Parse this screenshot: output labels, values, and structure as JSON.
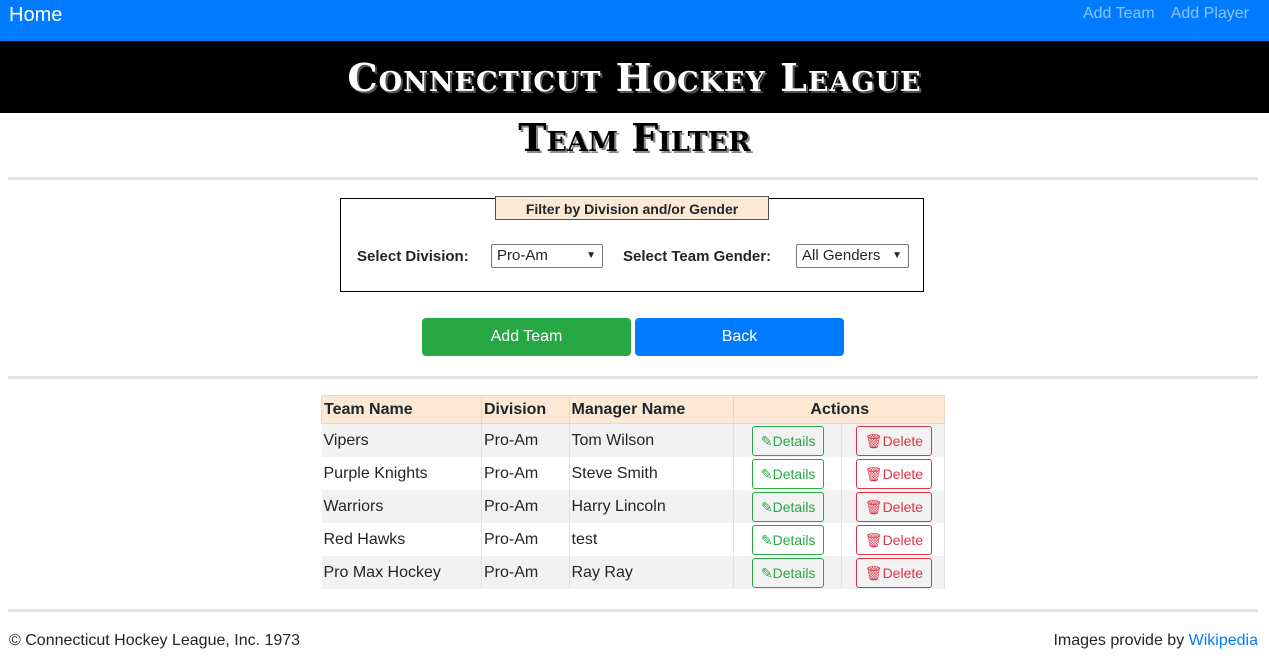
{
  "nav": {
    "brand": "Home",
    "links": [
      "Add Team",
      "Add Player"
    ]
  },
  "banner": {
    "title": "Connecticut Hockey League"
  },
  "page": {
    "title": "Team Filter"
  },
  "filter": {
    "legend": "Filter by Division and/or Gender",
    "division_label": "Select Division:",
    "division_value": "Pro-Am",
    "gender_label": "Select Team Gender:",
    "gender_value": "All Genders"
  },
  "buttons": {
    "add_team": "Add Team",
    "back": "Back"
  },
  "table": {
    "headers": [
      "Team Name",
      "Division",
      "Manager Name",
      "Actions"
    ],
    "details_label": "Details",
    "delete_label": "Delete",
    "rows": [
      {
        "team": "Vipers",
        "division": "Pro-Am",
        "manager": "Tom Wilson"
      },
      {
        "team": "Purple Knights",
        "division": "Pro-Am",
        "manager": "Steve Smith"
      },
      {
        "team": "Warriors",
        "division": "Pro-Am",
        "manager": "Harry Lincoln"
      },
      {
        "team": "Red Hawks",
        "division": "Pro-Am",
        "manager": "test"
      },
      {
        "team": "Pro Max Hockey",
        "division": "Pro-Am",
        "manager": "Ray Ray"
      }
    ]
  },
  "footer": {
    "copyright": "© Connecticut Hockey League, Inc. 1973",
    "credit_prefix": "Images provide by ",
    "credit_link": "Wikipedia"
  },
  "colors": {
    "navbar": "#007bff",
    "banner": "#000000",
    "accent_header": "#fbe9d5",
    "success": "#28a745",
    "danger": "#dc3545"
  },
  "icons": [
    "edit-icon",
    "trash-icon",
    "dropdown-arrow-icon"
  ]
}
